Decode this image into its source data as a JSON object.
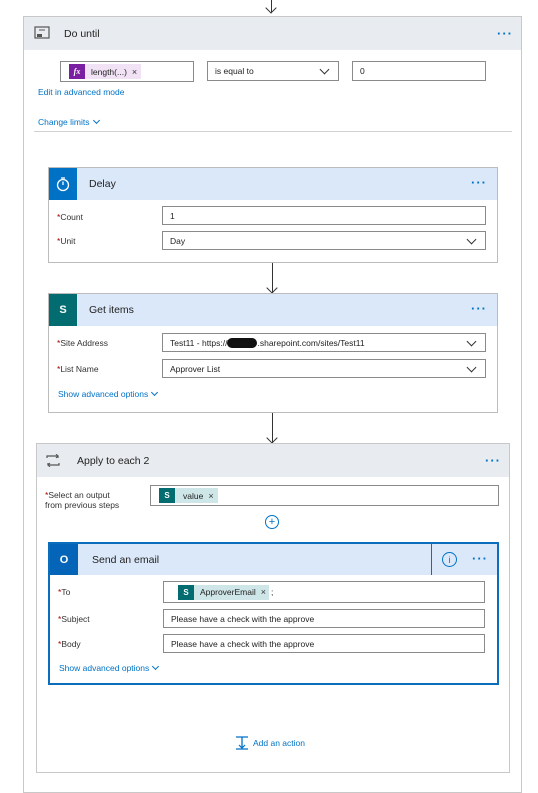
{
  "do_until": {
    "title": "Do until",
    "condition_token": "length(...)",
    "operator": "is equal to",
    "value": "0",
    "edit_advanced": "Edit in advanced mode",
    "change_limits": "Change limits"
  },
  "delay": {
    "title": "Delay",
    "count_label": "Count",
    "count_value": "1",
    "unit_label": "Unit",
    "unit_value": "Day"
  },
  "get_items": {
    "title": "Get items",
    "site_label": "Site Address",
    "site_prefix": "Test11 - https://",
    "site_suffix": ".sharepoint.com/sites/Test11",
    "list_label": "List Name",
    "list_value": "Approver List",
    "advanced": "Show advanced options"
  },
  "apply_each": {
    "title": "Apply to each 2",
    "select_label_1": "Select an output",
    "select_label_2": "from previous steps",
    "token": "value"
  },
  "send_email": {
    "title": "Send an email",
    "to_label": "To",
    "to_token": "ApproverEmail",
    "to_suffix": ";",
    "subject_label": "Subject",
    "subject_value": "Please have a check with the approve",
    "body_label": "Body",
    "body_value": "Please have a check with the approve",
    "advanced": "Show advanced options"
  },
  "add_action": "Add an action",
  "symbols": {
    "required": "*",
    "ellipsis": "···",
    "remove": "×",
    "fx": "fx",
    "sharepoint_letter": "S",
    "outlook_letter": "O",
    "plus": "+",
    "info": "i"
  },
  "colors": {
    "accent": "#0072c6",
    "selected_header": "#dbe8f9",
    "loop_header": "#e8ebef",
    "sharepoint": "#036c70",
    "outlook": "#0364b8",
    "fx": "#7b1fa2"
  }
}
